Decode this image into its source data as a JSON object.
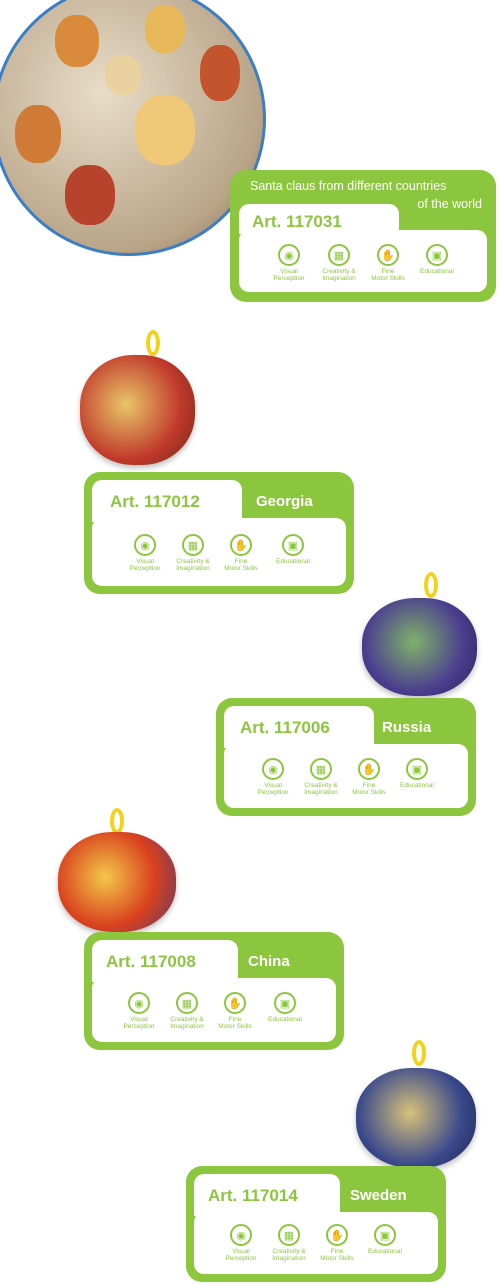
{
  "header": {
    "title_line1": "Santa claus from different countries",
    "title_line2": "of the world"
  },
  "skills": {
    "visual": "Visual\nPerception",
    "creativity": "Creativity &\nImagination",
    "fine": "Fine\nMotor Skills",
    "educational": "Educational"
  },
  "icons": {
    "visual": "eye-icon",
    "creativity": "building-blocks-icon",
    "fine": "hand-icon",
    "educational": "book-icon"
  },
  "colors": {
    "accent": "#8cc63f",
    "hero_border": "#3a7ec3",
    "ribbon": "#f2d21b"
  },
  "products": [
    {
      "art": "Art. 117031",
      "country": ""
    },
    {
      "art": "Art. 117012",
      "country": "Georgia"
    },
    {
      "art": "Art. 117006",
      "country": "Russia"
    },
    {
      "art": "Art. 117008",
      "country": "China"
    },
    {
      "art": "Art. 117014",
      "country": "Sweden"
    }
  ]
}
